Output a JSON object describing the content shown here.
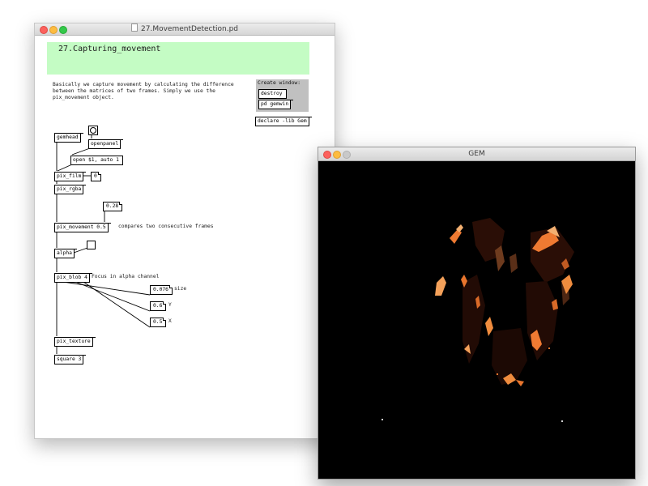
{
  "pd_window": {
    "title": "27.MovementDetection.pd",
    "header": "27.Capturing_movement",
    "description": "Basically we capture movement by calculating the difference\nbetween the matrices of two frames. Simply we use the\npix_movement object.",
    "create_window": {
      "label": "Create window:",
      "destroy": "destroy",
      "gemwin": "pd gemwin"
    },
    "declare": "declare -lib Gem",
    "objects": {
      "gemhead": "gemhead",
      "openpanel": "openpanel",
      "open_msg": "open $1, auto 1",
      "pix_film": "pix_film",
      "pix_film_num": "0",
      "pix_rgba": "pix_rgba",
      "threshold": "0.28",
      "pix_movement": "pix_movement 0.5",
      "pix_movement_comment": "compares two consecutive frames",
      "alpha": "alpha",
      "pix_blob": "pix_blob 4",
      "pix_blob_comment": "Focus in alpha channel",
      "size_value": "0.076",
      "size_label": "size",
      "y_value": "0.6",
      "y_label": "Y",
      "x_value": "0.5",
      "x_label": "X",
      "pix_texture": "pix_texture",
      "square": "square 3"
    }
  },
  "gem_window": {
    "title": "GEM"
  }
}
